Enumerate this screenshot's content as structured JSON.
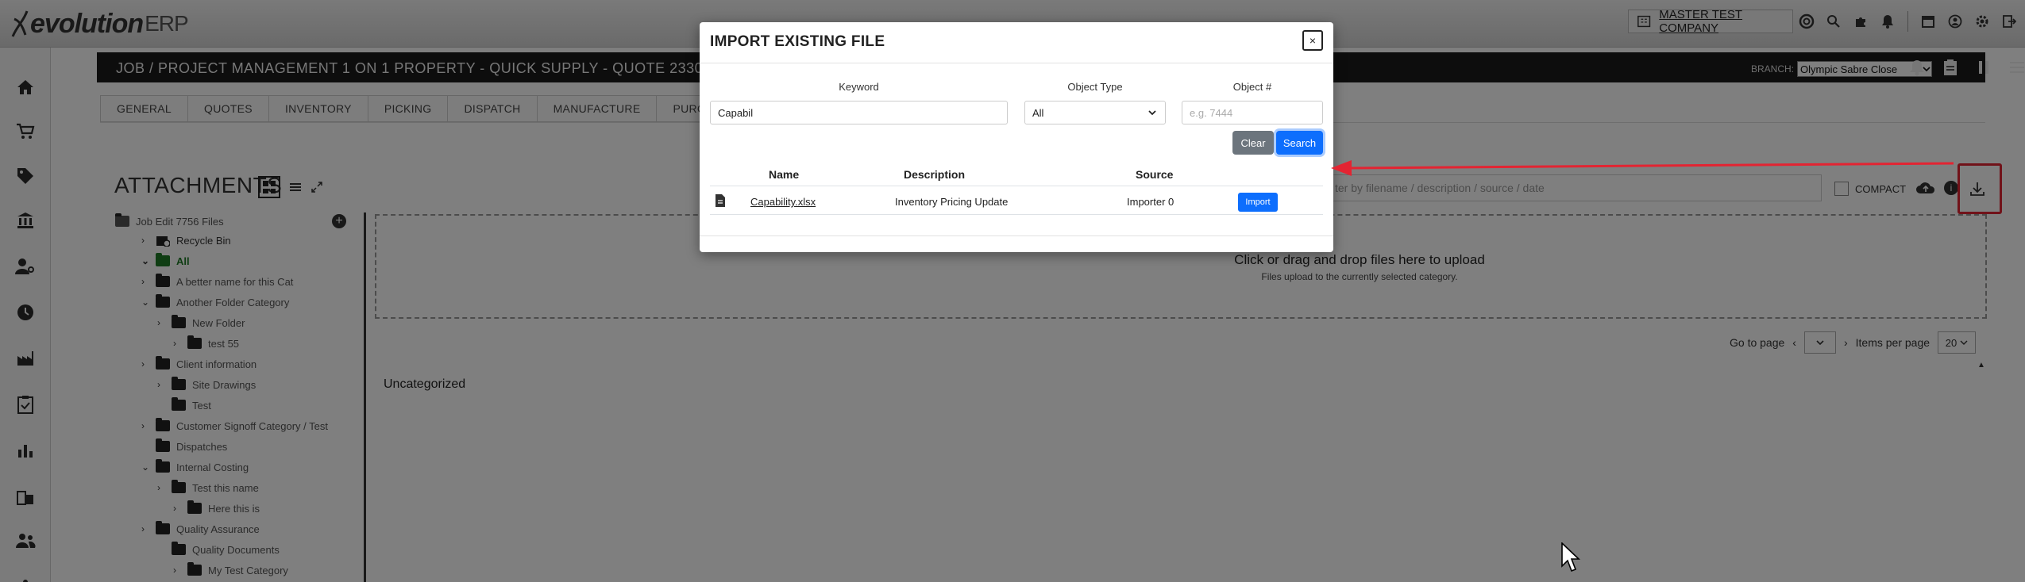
{
  "app": {
    "logo_text": "evolution",
    "logo_suffix": "ERP",
    "company": "MASTER TEST COMPANY"
  },
  "titlebar": {
    "title": "JOB / PROJECT MANAGEMENT 1 ON 1 PROPERTY - QUICK SUPPLY - QUOTE 23309 (7756)",
    "branch_label": "BRANCH:",
    "branch_value": "Olympic Sabre Close"
  },
  "tabs": [
    "GENERAL",
    "QUOTES",
    "INVENTORY",
    "PICKING",
    "DISPATCH",
    "MANUFACTURE",
    "PURCHASING"
  ],
  "attachments": {
    "title": "ATTACHMENTS",
    "filter_placeholder": "ter by filename / description / source / date",
    "compact_label": "COMPACT",
    "drop_main": "Click or drag and drop files here to upload",
    "drop_sub": "Files upload to the currently selected category.",
    "goto_label": "Go to page",
    "per_page_label": "Items per page",
    "per_page_value": "20",
    "uncategorized": "Uncategorized"
  },
  "tree": {
    "root": "Job Edit 7756 Files",
    "items": [
      {
        "label": "Recycle Bin"
      },
      {
        "label": "All"
      },
      {
        "label": "A better name for this Cat"
      },
      {
        "label": "Another Folder Category"
      },
      {
        "label": "New Folder"
      },
      {
        "label": "test 55"
      },
      {
        "label": "Client information"
      },
      {
        "label": "Site Drawings"
      },
      {
        "label": "Test"
      },
      {
        "label": "Customer Signoff Category / Test"
      },
      {
        "label": "Dispatches"
      },
      {
        "label": "Internal Costing"
      },
      {
        "label": "Test this name"
      },
      {
        "label": "Here this is"
      },
      {
        "label": "Quality Assurance"
      },
      {
        "label": "Quality Documents"
      },
      {
        "label": "My Test Category"
      }
    ]
  },
  "modal": {
    "title": "IMPORT EXISTING FILE",
    "close_label": "×",
    "keyword_label": "Keyword",
    "keyword_value": "Capabil",
    "object_type_label": "Object Type",
    "object_type_value": "All",
    "object_num_label": "Object #",
    "object_num_placeholder": "e.g. 7444",
    "clear_label": "Clear",
    "search_label": "Search",
    "columns": [
      "Name",
      "Description",
      "Source"
    ],
    "rows": [
      {
        "name": "Capability.xlsx",
        "description": "Inventory Pricing Update",
        "source": "Importer 0",
        "action": "Import"
      }
    ]
  },
  "colors": {
    "annotation_red": "#e32432",
    "primary_blue": "#0d6efd",
    "secondary_gray": "#6c757d",
    "active_green": "#1e7b27"
  }
}
